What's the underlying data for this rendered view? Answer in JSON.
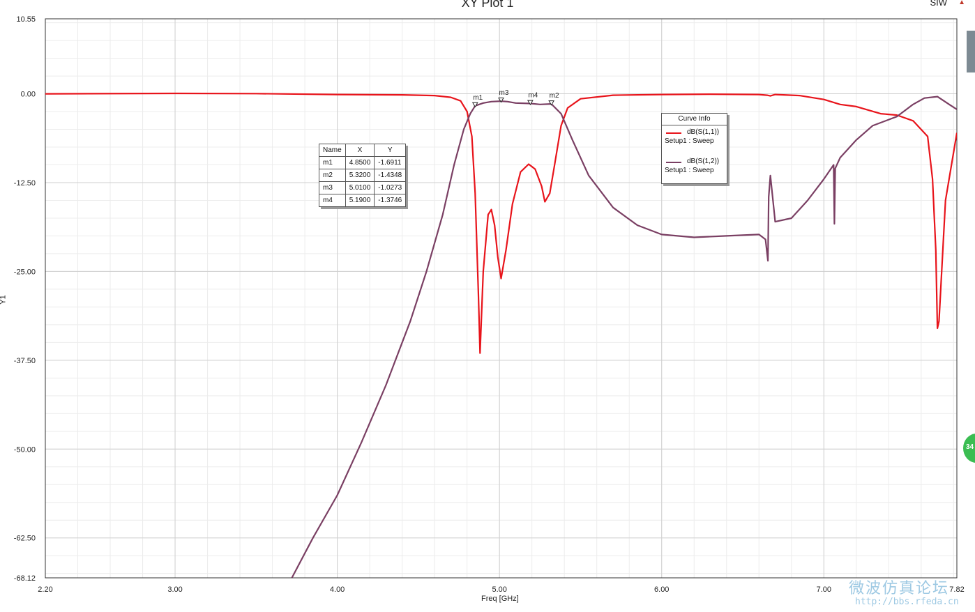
{
  "header": {
    "title": "XY Plot 1",
    "brand": "SIW"
  },
  "chart_data": {
    "type": "line",
    "title": "XY Plot 1",
    "xlabel": "Freq [GHz]",
    "ylabel": "Y1",
    "xlim": [
      2.2,
      7.82
    ],
    "ylim": [
      -68.12,
      10.55
    ],
    "grid": true,
    "x_ticks": [
      "2.20",
      "3.00",
      "4.00",
      "5.00",
      "6.00",
      "7.00",
      "7.82"
    ],
    "x_tick_values": [
      2.2,
      3.0,
      4.0,
      5.0,
      6.0,
      7.0,
      7.82
    ],
    "y_ticks": [
      "10.55",
      "0.00",
      "-12.50",
      "-25.00",
      "-37.50",
      "-50.00",
      "-62.50",
      "-68.12"
    ],
    "y_tick_values": [
      10.55,
      0,
      -12.5,
      -25,
      -37.5,
      -50,
      -62.5,
      -68.12
    ],
    "series": [
      {
        "name": "dB(S(1,1))",
        "setup": "Setup1 : Sweep",
        "color": "#e8141b",
        "x": [
          2.2,
          3.0,
          3.5,
          4.0,
          4.4,
          4.6,
          4.7,
          4.76,
          4.8,
          4.83,
          4.85,
          4.87,
          4.88,
          4.9,
          4.93,
          4.95,
          4.97,
          4.99,
          5.01,
          5.04,
          5.08,
          5.13,
          5.18,
          5.22,
          5.26,
          5.28,
          5.31,
          5.34,
          5.38,
          5.42,
          5.5,
          5.7,
          6.0,
          6.3,
          6.6,
          6.65,
          6.67,
          6.7,
          6.85,
          7.0,
          7.1,
          7.2,
          7.35,
          7.45,
          7.55,
          7.64,
          7.67,
          7.69,
          7.7,
          7.71,
          7.75,
          7.82
        ],
        "y": [
          0,
          0.05,
          0.02,
          -0.1,
          -0.15,
          -0.25,
          -0.5,
          -1.0,
          -2.5,
          -6.0,
          -14.0,
          -28.0,
          -36.5,
          -25.0,
          -17.0,
          -16.3,
          -18.5,
          -23.0,
          -26.0,
          -22.0,
          -15.5,
          -11.0,
          -9.9,
          -10.6,
          -13.0,
          -15.2,
          -14.0,
          -10.0,
          -4.5,
          -2.0,
          -0.7,
          -0.2,
          -0.1,
          -0.05,
          -0.1,
          -0.2,
          -0.3,
          -0.1,
          -0.25,
          -0.8,
          -1.5,
          -1.8,
          -2.8,
          -3.0,
          -3.8,
          -6.0,
          -12.0,
          -22.0,
          -33.0,
          -32.0,
          -15.0,
          -5.5
        ]
      },
      {
        "name": "dB(S(1,2))",
        "setup": "Setup1 : Sweep",
        "color": "#7a3f63",
        "x": [
          3.72,
          3.85,
          4.0,
          4.15,
          4.3,
          4.45,
          4.55,
          4.65,
          4.72,
          4.78,
          4.82,
          4.85,
          4.9,
          4.95,
          5.01,
          5.05,
          5.1,
          5.19,
          5.25,
          5.32,
          5.38,
          5.45,
          5.55,
          5.7,
          5.85,
          6.0,
          6.2,
          6.4,
          6.6,
          6.64,
          6.655,
          6.66,
          6.67,
          6.7,
          6.8,
          6.9,
          7.0,
          7.06,
          7.065,
          7.07,
          7.1,
          7.2,
          7.3,
          7.45,
          7.55,
          7.62,
          7.7,
          7.78,
          7.82
        ],
        "y": [
          -68.12,
          -62.5,
          -56.5,
          -49.0,
          -41.0,
          -32.0,
          -25.0,
          -17.0,
          -10.0,
          -5.0,
          -2.8,
          -1.69,
          -1.3,
          -1.1,
          -1.03,
          -1.1,
          -1.3,
          -1.37,
          -1.5,
          -1.43,
          -2.8,
          -6.5,
          -11.5,
          -16.0,
          -18.5,
          -19.8,
          -20.2,
          -20.0,
          -19.8,
          -20.5,
          -23.5,
          -14.5,
          -11.5,
          -18.0,
          -17.5,
          -15.0,
          -12.0,
          -10.0,
          -18.3,
          -10.5,
          -9.0,
          -6.5,
          -4.5,
          -3.2,
          -1.5,
          -0.6,
          -0.4,
          -1.6,
          -2.2
        ]
      }
    ],
    "markers": [
      {
        "name": "m1",
        "x": 4.85,
        "y": -1.6911,
        "x_text": "4.8500",
        "y_text": "-1.6911"
      },
      {
        "name": "m2",
        "x": 5.32,
        "y": -1.4348,
        "x_text": "5.3200",
        "y_text": "-1.4348"
      },
      {
        "name": "m3",
        "x": 5.01,
        "y": -1.0273,
        "x_text": "5.0100",
        "y_text": "-1.0273"
      },
      {
        "name": "m4",
        "x": 5.19,
        "y": -1.3746,
        "x_text": "5.1900",
        "y_text": "-1.3746"
      }
    ],
    "marker_table_headers": [
      "Name",
      "X",
      "Y"
    ],
    "curve_info_title": "Curve Info"
  },
  "overlay": {
    "badge": "34",
    "watermark": "微波仿真论坛",
    "watermark_url": "http://bbs.rfeda.cn"
  }
}
